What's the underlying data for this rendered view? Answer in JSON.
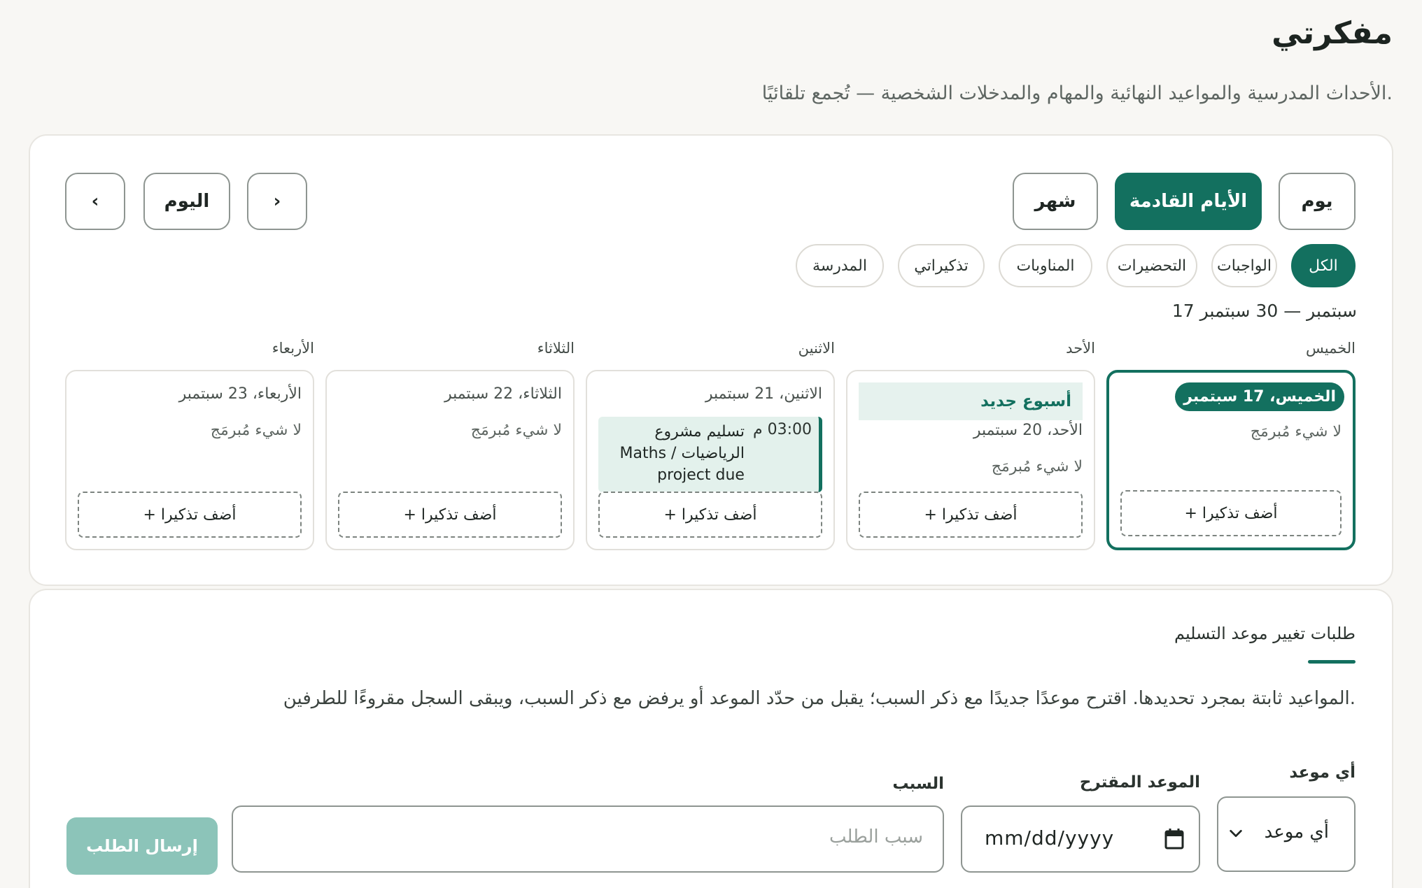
{
  "header": {
    "title": "مفكرتي",
    "subtitle": "الأحداث المدرسية والمواعيد النهائية والمهام والمدخلات الشخصية — تُجمع تلقائيًا."
  },
  "colors": {
    "accent": "#13705f",
    "accent_light": "#e3f1ec",
    "submit_disabled": "#8cc4b9"
  },
  "toolbar": {
    "view_buttons": [
      "يوم",
      "الأيام القادمة",
      "شهر"
    ],
    "active_view": "الأيام القادمة",
    "nav": {
      "prev": "›",
      "today": "اليوم",
      "next": "‹"
    }
  },
  "filters": {
    "chips": [
      "الكل",
      "الواجبات",
      "التحضيرات",
      "المناوبات",
      "تذكيراتي",
      "المدرسة"
    ],
    "active": "الكل"
  },
  "range_label": "17 سبتمبر — 30 سبتمبر",
  "days": [
    {
      "dow": "الخميس",
      "date": "الخميس، 17 سبتمبر",
      "empty": "لا شيء مُبرمَج",
      "add": "+ أضف تذكيرا",
      "is_today": true
    },
    {
      "dow": "الأحد",
      "banner": "أسبوع جديد",
      "date": "الأحد، 20 سبتمبر",
      "empty": "لا شيء مُبرمَج",
      "add": "+ أضف تذكيرا"
    },
    {
      "dow": "الاثنين",
      "date": "الاثنين، 21 سبتمبر",
      "add": "+ أضف تذكيرا",
      "event": {
        "time": "03:00 م",
        "title": "تسليم مشروع الرياضيات / Maths project due"
      }
    },
    {
      "dow": "الثلاثاء",
      "date": "الثلاثاء، 22 سبتمبر",
      "empty": "لا شيء مُبرمَج",
      "add": "+ أضف تذكيرا"
    },
    {
      "dow": "الأربعاء",
      "date": "الأربعاء، 23 سبتمبر",
      "empty": "لا شيء مُبرمَج",
      "add": "+ أضف تذكيرا"
    }
  ],
  "requests": {
    "title": "طلبات تغيير موعد التسليم",
    "description": "المواعيد ثابتة بمجرد تحديدها. اقترح موعدًا جديدًا مع ذكر السبب؛ يقبل من حدّد الموعد أو يرفض مع ذكر السبب، ويبقى السجل مقروءًا للطرفين.",
    "deadline_label": "أي موعد",
    "deadline_value": "أي موعد",
    "proposed_label": "الموعد المقترح",
    "proposed_value": "mm/dd/yyyy",
    "reason_label": "السبب",
    "reason_placeholder": "سبب الطلب",
    "submit": "إرسال الطلب"
  }
}
